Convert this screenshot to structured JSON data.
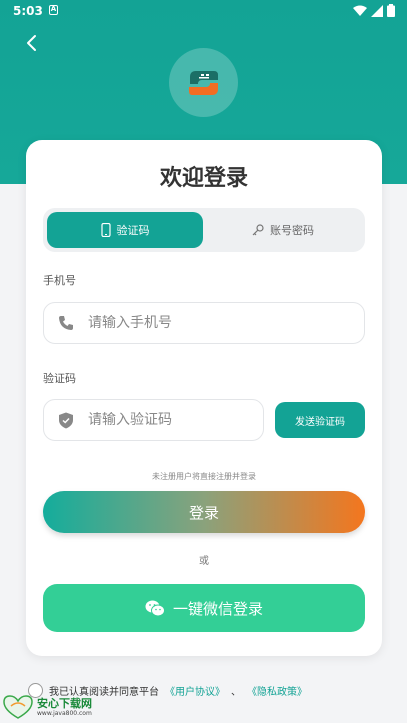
{
  "status_bar": {
    "time": "5:03",
    "a_icon": "A"
  },
  "card": {
    "title": "欢迎登录",
    "tabs": [
      {
        "label": "验证码",
        "icon": "phone-icon",
        "active": true
      },
      {
        "label": "账号密码",
        "icon": "key-icon",
        "active": false
      }
    ],
    "phone": {
      "label": "手机号",
      "placeholder": "请输入手机号",
      "value": ""
    },
    "code": {
      "label": "验证码",
      "placeholder": "请输入验证码",
      "value": ""
    },
    "send_code_label": "发送验证码",
    "hint": "未注册用户将直接注册并登录",
    "login_label": "登录",
    "or_text": "或",
    "wechat_label": "一键微信登录"
  },
  "agreement": {
    "prefix": "我已认真阅读并同意平台",
    "user_agreement": "《用户协议》",
    "separator": "、",
    "privacy_policy": "《隐私政策》"
  },
  "watermark": {
    "title": "安心下载网",
    "url": "www.java800.com"
  },
  "colors": {
    "primary": "#13a395",
    "wechat": "#33cf96",
    "login_gradient_end": "#f4761e"
  }
}
